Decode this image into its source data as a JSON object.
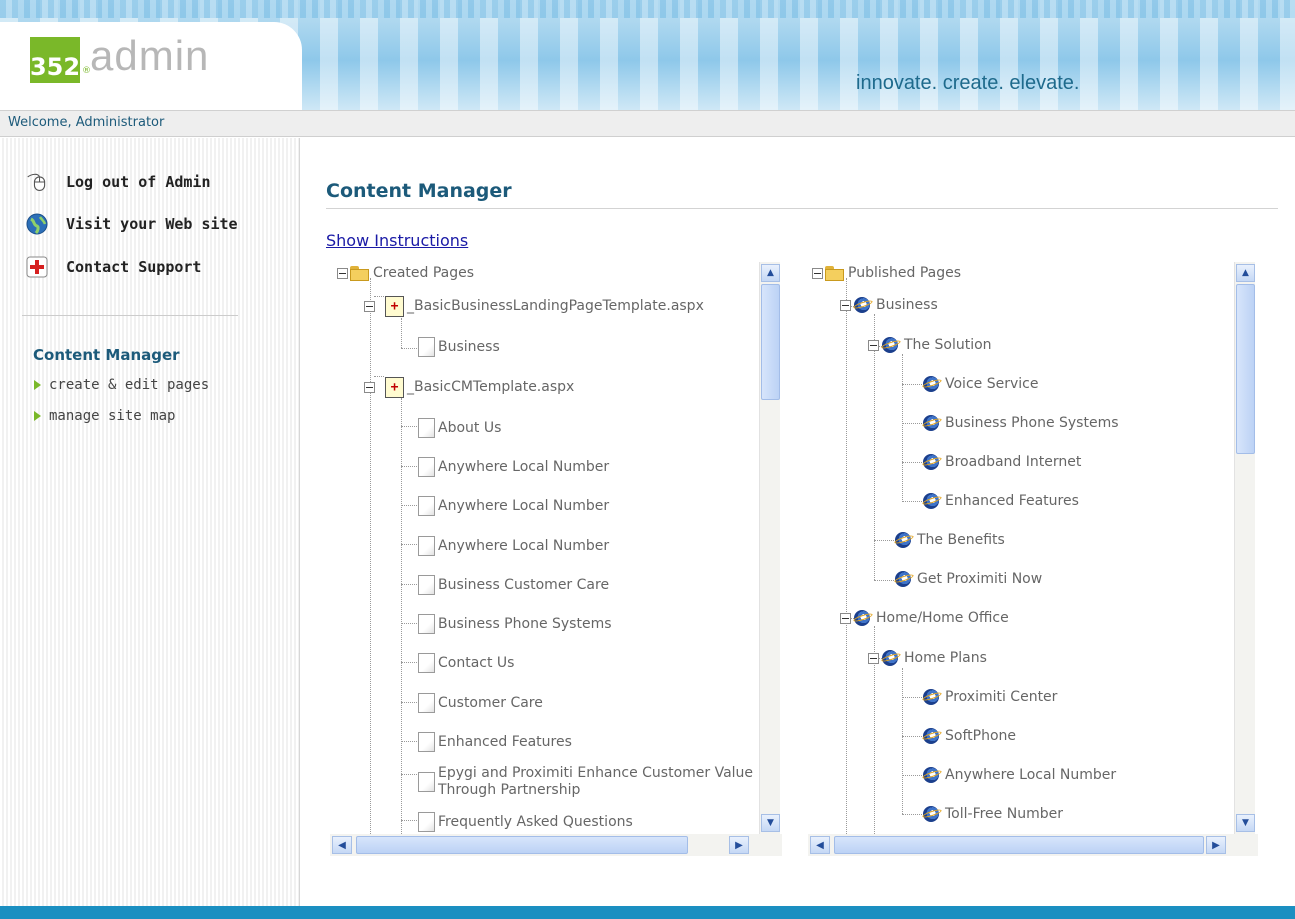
{
  "header": {
    "logo_number": "352",
    "logo_reg": "®",
    "logo_word": "admin",
    "tagline": "innovate. create. elevate."
  },
  "welcome": "Welcome, Administrator",
  "sidebar": {
    "links": [
      {
        "label": "Log out of Admin",
        "icon": "mouse-icon"
      },
      {
        "label": "Visit your Web site",
        "icon": "globe-icon"
      },
      {
        "label": "Contact Support",
        "icon": "first-aid-icon"
      }
    ],
    "section_title": "Content Manager",
    "sub_links": [
      "create & edit pages",
      "manage site map"
    ]
  },
  "main": {
    "title": "Content Manager",
    "instructions_link": "Show Instructions"
  },
  "created_tree": {
    "root": "Created Pages",
    "templates": [
      {
        "name": "_BasicBusinessLandingPageTemplate.aspx",
        "pages": [
          "Business"
        ]
      },
      {
        "name": "_BasicCMTemplate.aspx",
        "pages": [
          "About Us",
          "Anywhere Local Number",
          "Anywhere Local Number",
          "Anywhere Local Number",
          "Business Customer Care",
          "Business Phone Systems",
          "Contact Us",
          "Customer Care",
          "Enhanced Features",
          "Epygi and Proximiti Enhance Customer Value Through Partnership",
          "Frequently Asked Questions"
        ]
      }
    ]
  },
  "published_tree": {
    "root": "Published Pages",
    "business": {
      "label": "Business",
      "solution": {
        "label": "The Solution",
        "children": [
          "Voice Service",
          "Business Phone Systems",
          "Broadband Internet",
          "Enhanced Features"
        ]
      },
      "siblings": [
        "The Benefits",
        "Get Proximiti Now"
      ]
    },
    "home": {
      "label": "Home/Home Office",
      "plans": {
        "label": "Home Plans",
        "children": [
          "Proximiti Center",
          "SoftPhone",
          "Anywhere Local Number",
          "Toll-Free Number"
        ]
      }
    }
  },
  "scrollbar_glyphs": {
    "up": "▲",
    "down": "▼",
    "left": "◀",
    "right": "▶",
    "grip": "≡"
  },
  "colors": {
    "accent_blue": "#1c5a7a",
    "logo_green": "#7ab829",
    "link": "#1a1aa6",
    "footer": "#1b8fc1"
  }
}
